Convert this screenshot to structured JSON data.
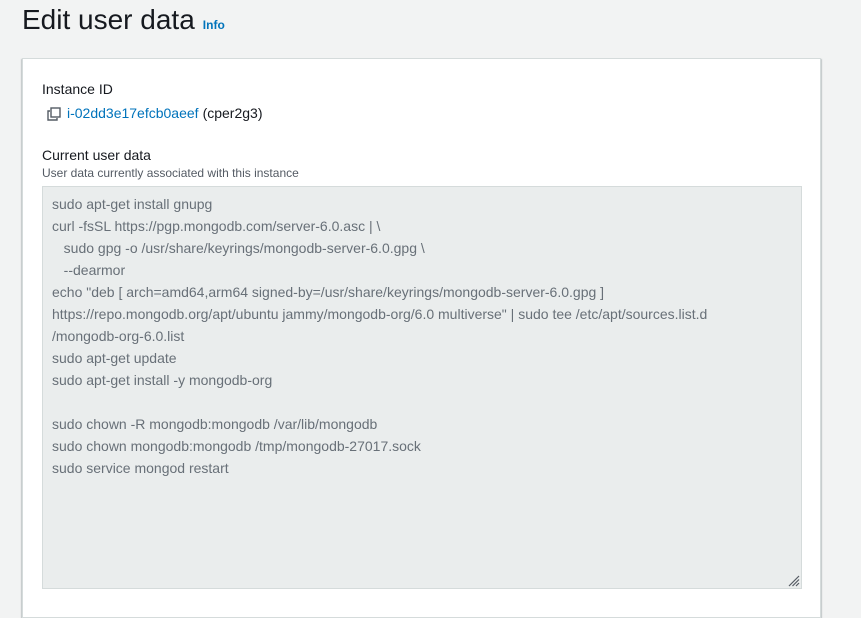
{
  "page": {
    "title": "Edit user data",
    "info_label": "Info"
  },
  "instance": {
    "label": "Instance ID",
    "id": "i-02dd3e17efcb0aeef",
    "name": "(cper2g3)",
    "copy_icon": "copy-icon"
  },
  "user_data": {
    "label": "Current user data",
    "description": "User data currently associated with this instance",
    "content": "sudo apt-get install gnupg\ncurl -fsSL https://pgp.mongodb.com/server-6.0.asc | \\\n   sudo gpg -o /usr/share/keyrings/mongodb-server-6.0.gpg \\\n   --dearmor\necho \"deb [ arch=amd64,arm64 signed-by=/usr/share/keyrings/mongodb-server-6.0.gpg ]\nhttps://repo.mongodb.org/apt/ubuntu jammy/mongodb-org/6.0 multiverse\" | sudo tee /etc/apt/sources.list.d\n/mongodb-org-6.0.list\nsudo apt-get update\nsudo apt-get install -y mongodb-org\n\nsudo chown -R mongodb:mongodb /var/lib/mongodb\nsudo chown mongodb:mongodb /tmp/mongodb-27017.sock\nsudo service mongod restart",
    "resize_icon": "resize-handle-icon"
  },
  "colors": {
    "link": "#0073bb",
    "page_bg": "#f2f3f3",
    "textarea_bg": "#eaeded"
  }
}
